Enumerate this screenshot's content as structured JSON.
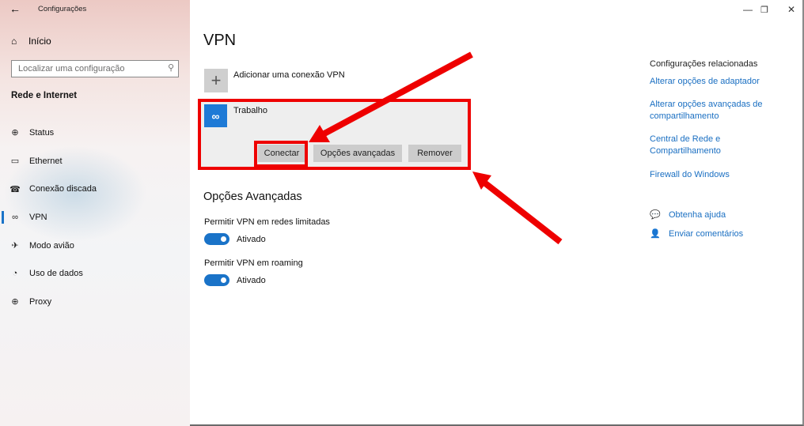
{
  "window": {
    "title": "Configurações",
    "controls": {
      "minimize": "—",
      "maximize": "❐",
      "close": "✕"
    }
  },
  "sidebar": {
    "home_label": "Início",
    "search_placeholder": "Localizar uma configuração",
    "section_title": "Rede e Internet",
    "items": [
      {
        "label": "Status",
        "icon": "globe-status-icon",
        "glyph": "⊕",
        "active": false
      },
      {
        "label": "Ethernet",
        "icon": "ethernet-icon",
        "glyph": "🖳",
        "active": false
      },
      {
        "label": "Conexão discada",
        "icon": "dialup-icon",
        "glyph": "☎",
        "active": false
      },
      {
        "label": "VPN",
        "icon": "vpn-icon",
        "glyph": "∞",
        "active": true
      },
      {
        "label": "Modo avião",
        "icon": "airplane-icon",
        "glyph": "✈",
        "active": false
      },
      {
        "label": "Uso de dados",
        "icon": "data-usage-icon",
        "glyph": "◔",
        "active": false
      },
      {
        "label": "Proxy",
        "icon": "proxy-globe-icon",
        "glyph": "⊕",
        "active": false
      }
    ]
  },
  "main": {
    "title": "VPN",
    "add_vpn_label": "Adicionar uma conexão VPN",
    "add_vpn_glyph": "+",
    "connection": {
      "name": "Trabalho",
      "icon_glyph": "∞",
      "buttons": {
        "connect": "Conectar",
        "advanced": "Opções avançadas",
        "remove": "Remover"
      }
    },
    "advanced_title": "Opções Avançadas",
    "options": [
      {
        "label": "Permitir VPN em redes limitadas",
        "state": "Ativado",
        "on": true
      },
      {
        "label": "Permitir VPN em roaming",
        "state": "Ativado",
        "on": true
      }
    ]
  },
  "related": {
    "title": "Configurações relacionadas",
    "links": [
      "Alterar opções de adaptador",
      "Alterar opções avançadas de compartilhamento",
      "Central de Rede e Compartilhamento",
      "Firewall do Windows"
    ],
    "help": [
      {
        "label": "Obtenha ajuda",
        "icon": "help-chat-icon",
        "glyph": "💬"
      },
      {
        "label": "Enviar comentários",
        "icon": "feedback-icon",
        "glyph": "👤"
      }
    ]
  },
  "colors": {
    "accent": "#1a73c8",
    "annotation": "#ee0000",
    "vpn_tile": "#1e7ad6"
  }
}
